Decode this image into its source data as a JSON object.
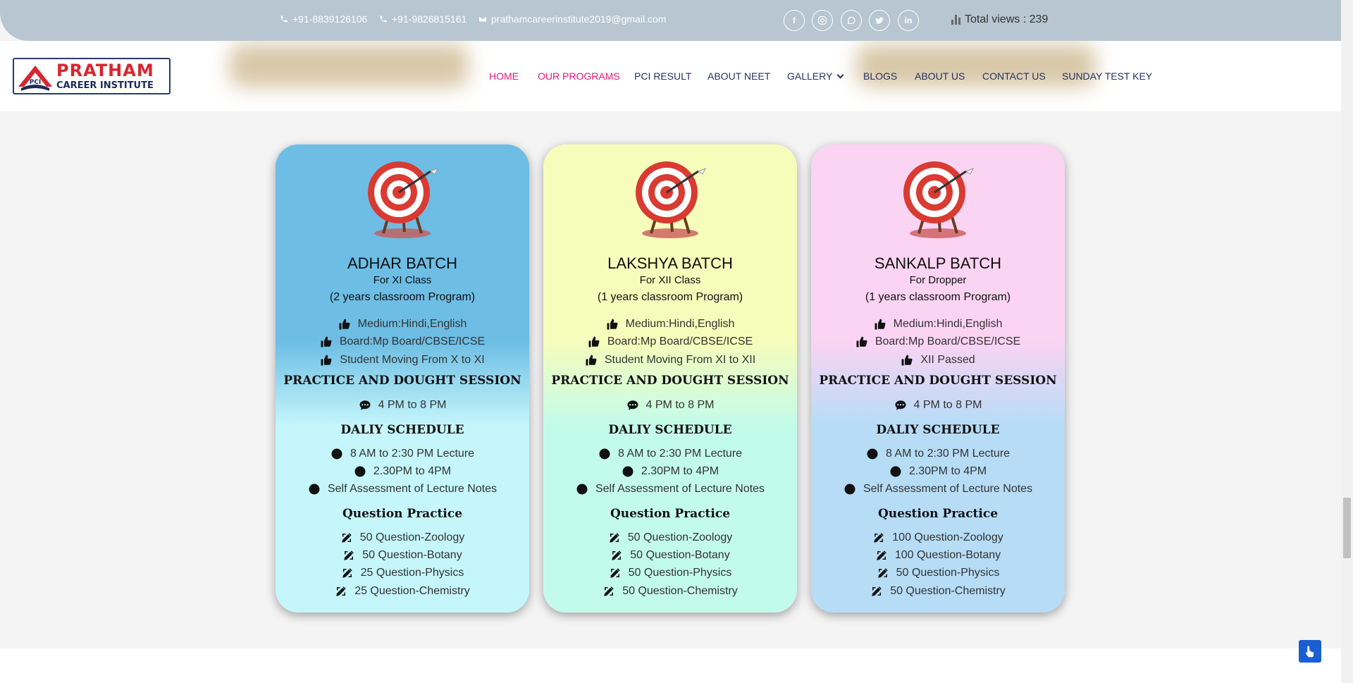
{
  "topbar": {
    "phone1": "+91-8839126106",
    "phone2": "+91-9826815161",
    "email": "prathamcareerinstitute2019@gmail.com",
    "social": [
      "facebook-icon",
      "instagram-icon",
      "whatsapp-icon",
      "twitter-icon",
      "linkedin-icon"
    ],
    "views_text": "Total views : 239"
  },
  "logo": {
    "line1": "PRATHAM",
    "line2": "CAREER INSTITUTE",
    "mark": "PCI"
  },
  "nav": {
    "items": [
      {
        "label": "HOME",
        "active": true
      },
      {
        "label": "OUR PROGRAMS",
        "active": true
      },
      {
        "label": "PCI RESULT",
        "active": false
      },
      {
        "label": "ABOUT NEET",
        "active": false
      },
      {
        "label": "GALLERY",
        "active": false
      },
      {
        "label": "BLOGS",
        "active": false
      },
      {
        "label": "ABOUT US",
        "active": false
      },
      {
        "label": "CONTACT US",
        "active": false
      },
      {
        "label": "SUNDAY TEST KEY",
        "active": false
      }
    ]
  },
  "colors": {
    "accent": "#e6197a",
    "nav": "#26325e",
    "topbar": "#b7c6d0"
  },
  "cards": [
    {
      "title": "ADHAR BATCH",
      "for": "For XI Class",
      "program": "(2 years classroom Program)",
      "features": [
        "Medium:Hindi,English",
        "Board:Mp Board/CBSE/ICSE",
        "Student Moving From X to XI"
      ],
      "practice_heading": "PRACTICE AND DOUGHT SESSION",
      "practice_time": "4 PM to 8 PM",
      "schedule_heading": "DALIY SCHEDULE",
      "schedule": [
        "8 AM to 2:30 PM Lecture",
        "2.30PM to 4PM",
        "Self Assessment of Lecture Notes"
      ],
      "question_heading": "Question Practice",
      "questions": [
        "50 Question-Zoology",
        "50 Question-Botany",
        "25 Question-Physics",
        "25 Question-Chemistry"
      ],
      "gradient": [
        "#6dbde4",
        "#6dbde4",
        "#c4f6fb"
      ]
    },
    {
      "title": "LAKSHYA BATCH",
      "for": "For XII Class",
      "program": "(1 years classroom Program)",
      "features": [
        "Medium:Hindi,English",
        "Board:Mp Board/CBSE/ICSE",
        "Student Moving From XI to XII"
      ],
      "practice_heading": "PRACTICE AND DOUGHT SESSION",
      "practice_time": "4 PM to 8 PM",
      "schedule_heading": "DALIY SCHEDULE",
      "schedule": [
        "8 AM to 2:30 PM Lecture",
        "2.30PM to 4PM",
        "Self Assessment of Lecture Notes"
      ],
      "question_heading": "Question Practice",
      "questions": [
        "50 Question-Zoology",
        "50 Question-Botany",
        "50 Question-Physics",
        "50 Question-Chemistry"
      ],
      "gradient": [
        "#f6fdbb",
        "#f6fdbb",
        "#c3fbea"
      ]
    },
    {
      "title": "SANKALP BATCH",
      "for": "For Dropper",
      "program": "(1 years classroom Program)",
      "features": [
        "Medium:Hindi,English",
        "Board:Mp Board/CBSE/ICSE",
        "XII Passed"
      ],
      "practice_heading": "PRACTICE AND DOUGHT SESSION",
      "practice_time": "4 PM to 8 PM",
      "schedule_heading": "DALIY SCHEDULE",
      "schedule": [
        "8 AM to 2:30 PM Lecture",
        "2.30PM to 4PM",
        "Self Assessment of Lecture Notes"
      ],
      "question_heading": "Question Practice",
      "questions": [
        "100 Question-Zoology",
        "100 Question-Botany",
        "50 Question-Physics",
        "50 Question-Chemistry"
      ],
      "gradient": [
        "#fbd3f3",
        "#fbd3f3",
        "#b6dcf6"
      ]
    }
  ]
}
